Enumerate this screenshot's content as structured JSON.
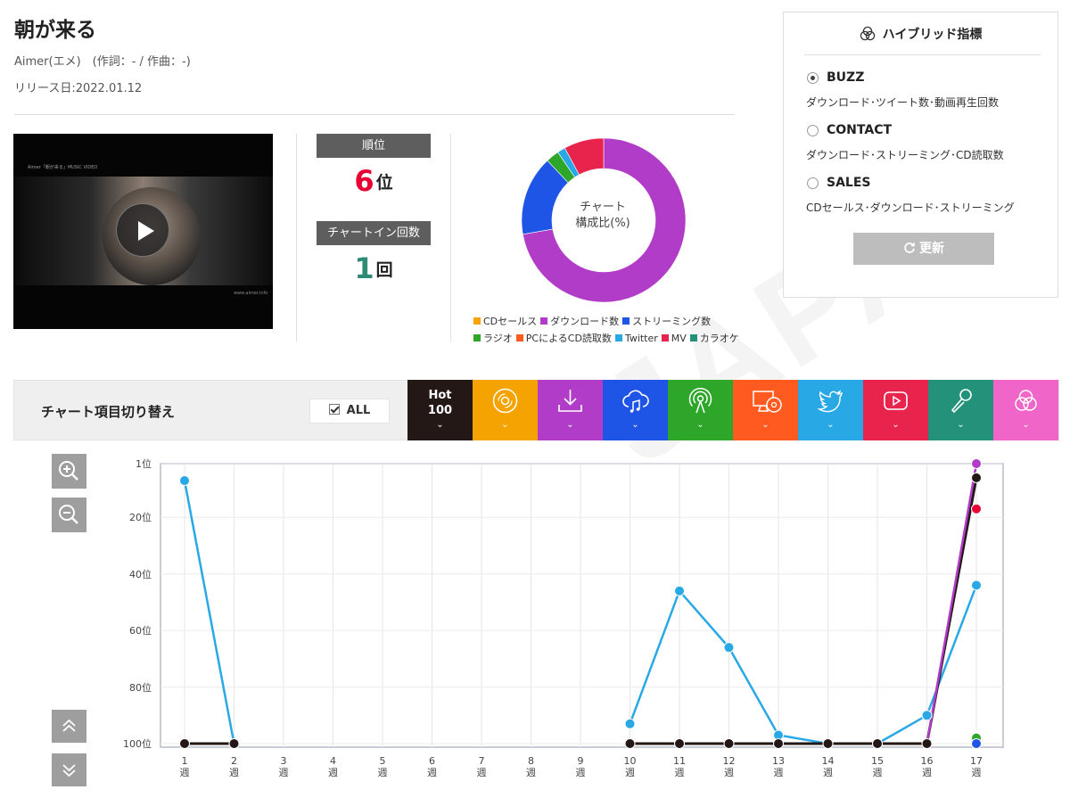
{
  "song": {
    "title": "朝が来る",
    "artist_line": "Aimer(エメ)　(作詞：- / 作曲：-)",
    "release_line": "リリース日:2022.01.12"
  },
  "video": {
    "caption_top": "Aimer「朝が来る」MUSIC VIDEO",
    "caption_bottom": "www.aimer.info",
    "play_icon": "play-icon"
  },
  "stats": {
    "rank_label": "順位",
    "rank_value": "6",
    "rank_unit": "位",
    "rank_color": "#e60033",
    "chart_in_label": "チャートイン回数",
    "chart_in_value": "1",
    "chart_in_unit": "回",
    "chart_in_color": "#2e8b76"
  },
  "donut": {
    "center_line1": "チャート",
    "center_line2": "構成比(%)",
    "legend": [
      {
        "label": "CDセールス",
        "color": "#f5a300"
      },
      {
        "label": "ダウンロード数",
        "color": "#b03cc8"
      },
      {
        "label": "ストリーミング数",
        "color": "#1e55e6"
      },
      {
        "label": "ラジオ",
        "color": "#2ea62a"
      },
      {
        "label": "PCによるCD読取数",
        "color": "#ff5a1f"
      },
      {
        "label": "Twitter",
        "color": "#29a8e6"
      },
      {
        "label": "MV",
        "color": "#e8244c"
      },
      {
        "label": "カラオケ",
        "color": "#24927a"
      }
    ]
  },
  "hybrid": {
    "title": "ハイブリッド指標",
    "icon": "overlapping-circles-icon",
    "options": [
      {
        "label": "BUZZ",
        "desc": "ダウンロード･ツイート数･動画再生回数",
        "checked": true
      },
      {
        "label": "CONTACT",
        "desc": "ダウンロード･ストリーミング･CD読取数",
        "checked": false
      },
      {
        "label": "SALES",
        "desc": "CDセールス･ダウンロード･ストリーミング",
        "checked": false
      }
    ],
    "refresh_label": "更新",
    "refresh_icon": "refresh-icon"
  },
  "toggle": {
    "title": "チャート項目切り替え",
    "all_label": "ALL",
    "hot_line1": "Hot",
    "hot_line2": "100",
    "chevron": "⌄",
    "tiles": [
      {
        "name": "hot100",
        "color": "#231815"
      },
      {
        "name": "cd-sales",
        "color": "#f5a300",
        "icon": "disc-icon"
      },
      {
        "name": "download",
        "color": "#b03cc8",
        "icon": "download-icon"
      },
      {
        "name": "streaming",
        "color": "#1e55e6",
        "icon": "cloud-music-icon"
      },
      {
        "name": "radio",
        "color": "#2ea62a",
        "icon": "radio-broadcast-icon"
      },
      {
        "name": "pc-cd-read",
        "color": "#ff5a1f",
        "icon": "pc-disc-icon"
      },
      {
        "name": "twitter",
        "color": "#29a8e6",
        "icon": "twitter-bird-icon"
      },
      {
        "name": "mv",
        "color": "#e8244c",
        "icon": "video-play-icon"
      },
      {
        "name": "karaoke",
        "color": "#24927a",
        "icon": "microphone-icon"
      },
      {
        "name": "hybrid",
        "color": "#f065c8",
        "icon": "overlapping-circles-icon"
      }
    ]
  },
  "controls": {
    "zoom_in_icon": "zoom-in-icon",
    "zoom_out_icon": "zoom-out-icon",
    "up_icon": "double-chevron-up-icon",
    "down_icon": "double-chevron-down-icon"
  },
  "chart_data": [
    {
      "type": "pie",
      "categories": [
        "CDセールス",
        "ダウンロード数",
        "ストリーミング数",
        "ラジオ",
        "PCによるCD読取数",
        "Twitter",
        "MV",
        "カラオケ"
      ],
      "values": [
        0,
        69,
        15,
        2.5,
        0,
        1.5,
        7.5,
        0
      ]
    },
    {
      "type": "line",
      "x": [
        "1",
        "2",
        "3",
        "4",
        "5",
        "6",
        "7",
        "8",
        "9",
        "10",
        "11",
        "12",
        "13",
        "14",
        "15",
        "16",
        "17"
      ],
      "x_unit": "週",
      "y_ticks": [
        "1位",
        "20位",
        "40位",
        "60位",
        "80位",
        "100位"
      ],
      "y_range_rank": [
        1,
        100
      ],
      "y_reversed": true,
      "grid": true,
      "series": [
        {
          "color": "#29a8e6",
          "values": [
            7,
            100,
            null,
            null,
            null,
            null,
            null,
            null,
            null,
            93,
            46,
            66,
            97,
            100,
            100,
            90,
            44
          ]
        },
        {
          "color": "#b03cc8",
          "values": [
            null,
            null,
            null,
            null,
            null,
            null,
            null,
            null,
            null,
            null,
            null,
            null,
            null,
            null,
            null,
            null,
            1
          ]
        },
        {
          "color": "#231815",
          "values": [
            100,
            100,
            null,
            null,
            null,
            null,
            null,
            null,
            null,
            100,
            100,
            100,
            100,
            100,
            100,
            100,
            6
          ]
        },
        {
          "color": "#e60033",
          "values": [
            null,
            null,
            null,
            null,
            null,
            null,
            null,
            null,
            null,
            null,
            null,
            null,
            null,
            null,
            null,
            null,
            17
          ]
        },
        {
          "color": "#2ea62a",
          "values": [
            null,
            null,
            null,
            null,
            null,
            null,
            null,
            null,
            null,
            null,
            null,
            null,
            null,
            null,
            null,
            null,
            98
          ]
        },
        {
          "color": "#1e55e6",
          "values": [
            null,
            null,
            null,
            null,
            null,
            null,
            null,
            null,
            null,
            null,
            null,
            null,
            null,
            null,
            null,
            null,
            100
          ]
        }
      ]
    }
  ]
}
